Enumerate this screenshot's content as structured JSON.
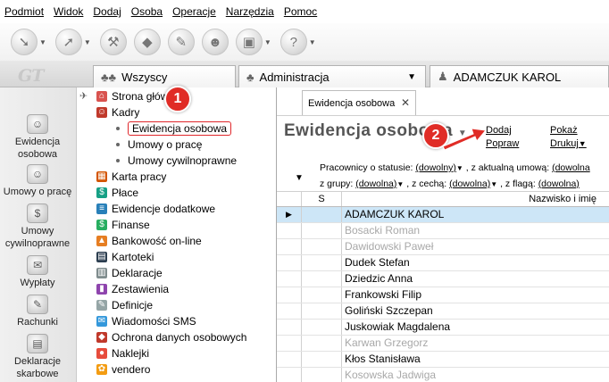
{
  "menu": [
    "Podmiot",
    "Widok",
    "Dodaj",
    "Osoba",
    "Operacje",
    "Narzędzia",
    "Pomoc"
  ],
  "logo": "GT",
  "tabs": [
    {
      "label": "Wszyscy"
    },
    {
      "label": "Administracja"
    },
    {
      "label": "ADAMCZUK KAROL"
    }
  ],
  "left_nav": [
    {
      "label_line1": "Ewidencja",
      "label_line2": "osobowa",
      "icon": "people-icon"
    },
    {
      "label_line1": "Umowy o pracę",
      "label_line2": "",
      "icon": "contract-icon"
    },
    {
      "label_line1": "Umowy",
      "label_line2": "cywilnoprawne",
      "icon": "civil-contract-icon"
    },
    {
      "label_line1": "Wypłaty",
      "label_line2": "",
      "icon": "money-icon"
    },
    {
      "label_line1": "Rachunki",
      "label_line2": "",
      "icon": "bill-icon"
    },
    {
      "label_line1": "Deklaracje",
      "label_line2": "skarbowe",
      "icon": "tax-icon"
    }
  ],
  "tree": {
    "items": [
      {
        "label": "Strona główna",
        "icon_color": "#d9534f"
      },
      {
        "label": "Kadry",
        "icon_color": "#c0392b"
      },
      {
        "label": "Ewidencja osobowa"
      },
      {
        "label": "Umowy o pracę"
      },
      {
        "label": "Umowy cywilnoprawne"
      },
      {
        "label": "Karta pracy",
        "icon_color": "#d35400"
      },
      {
        "label": "Płace",
        "icon_color": "#16a085"
      },
      {
        "label": "Ewidencje dodatkowe",
        "icon_color": "#2980b9"
      },
      {
        "label": "Finanse",
        "icon_color": "#27ae60"
      },
      {
        "label": "Bankowość on-line",
        "icon_color": "#e67e22"
      },
      {
        "label": "Kartoteki",
        "icon_color": "#2c3e50"
      },
      {
        "label": "Deklaracje",
        "icon_color": "#7f8c8d"
      },
      {
        "label": "Zestawienia",
        "icon_color": "#8e44ad"
      },
      {
        "label": "Definicje",
        "icon_color": "#95a5a6"
      },
      {
        "label": "Wiadomości SMS",
        "icon_color": "#3498db"
      },
      {
        "label": "Ochrona danych osobowych",
        "icon_color": "#c0392b"
      },
      {
        "label": "Naklejki",
        "icon_color": "#e74c3c"
      },
      {
        "label": "vendero",
        "icon_color": "#f39c12"
      }
    ]
  },
  "badges": {
    "one": "1",
    "two": "2"
  },
  "doc": {
    "tab_label": "Ewidencja osobowa",
    "title": "Ewidencja osobowa",
    "actions": {
      "dodaj": "Dodaj",
      "popraw": "Popraw",
      "pokaz": "Pokaż",
      "drukuj": "Drukuj"
    },
    "filters": {
      "status_label": "Pracownicy o statusie:",
      "status_value": "(dowolny)",
      "umowa_label": ", z aktualną umową:",
      "umowa_value": "(dowolna",
      "grupa_label": "z grupy:",
      "grupa_value": "(dowolna)",
      "cecha_label": ", z cechą:",
      "cecha_value": "(dowolna)",
      "flaga_label": ", z flagą:",
      "flaga_value": "(dowolna)"
    }
  },
  "grid": {
    "col_s": "S",
    "col_name": "Nazwisko i imię",
    "rows": [
      {
        "name": "ADAMCZUK KAROL",
        "selected": true,
        "inactive": false
      },
      {
        "name": "Bosacki Roman",
        "selected": false,
        "inactive": true
      },
      {
        "name": "Dawidowski Paweł",
        "selected": false,
        "inactive": true
      },
      {
        "name": "Dudek Stefan",
        "selected": false,
        "inactive": false
      },
      {
        "name": "Dziedzic Anna",
        "selected": false,
        "inactive": false
      },
      {
        "name": "Frankowski Filip",
        "selected": false,
        "inactive": false
      },
      {
        "name": "Goliński Szczepan",
        "selected": false,
        "inactive": false
      },
      {
        "name": "Juskowiak Magdalena",
        "selected": false,
        "inactive": false
      },
      {
        "name": "Karwan Grzegorz",
        "selected": false,
        "inactive": true
      },
      {
        "name": "Kłos Stanisława",
        "selected": false,
        "inactive": false
      },
      {
        "name": "Kosowska Jadwiga",
        "selected": false,
        "inactive": true
      }
    ]
  },
  "colors": {
    "accent_red": "#e02c26",
    "selection": "#cde6f7"
  }
}
